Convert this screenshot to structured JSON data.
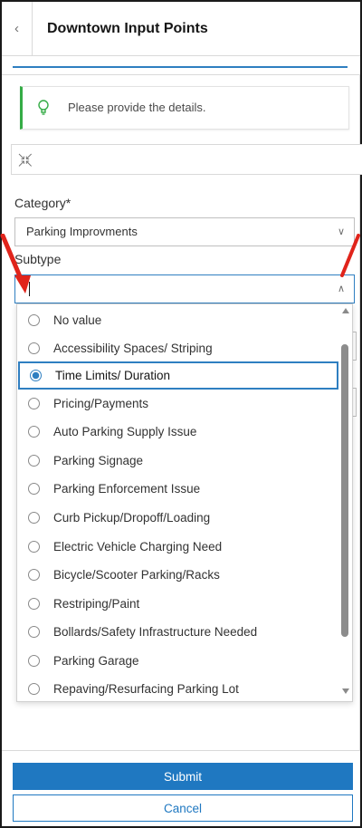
{
  "header": {
    "back_icon": "chevron-left-icon",
    "title": "Downtown Input Points"
  },
  "notice": {
    "icon": "lightbulb-icon",
    "text": "Please provide the details.",
    "accent_color": "#35ac46"
  },
  "collapse": {
    "icon": "collapse-arrows-icon"
  },
  "category": {
    "label": "Category*",
    "value": "Parking Improvments"
  },
  "subtype": {
    "label": "Subtype",
    "value": "",
    "options": [
      {
        "label": "No value",
        "selected": false
      },
      {
        "label": "Accessibility Spaces/ Striping",
        "selected": false
      },
      {
        "label": "Time Limits/ Duration",
        "selected": true
      },
      {
        "label": "Pricing/Payments",
        "selected": false
      },
      {
        "label": "Auto Parking Supply Issue",
        "selected": false
      },
      {
        "label": "Parking Signage",
        "selected": false
      },
      {
        "label": "Parking Enforcement Issue",
        "selected": false
      },
      {
        "label": "Curb Pickup/Dropoff/Loading",
        "selected": false
      },
      {
        "label": "Electric Vehicle Charging Need",
        "selected": false
      },
      {
        "label": "Bicycle/Scooter Parking/Racks",
        "selected": false
      },
      {
        "label": "Restriping/Paint",
        "selected": false
      },
      {
        "label": "Bollards/Safety Infrastructure Needed",
        "selected": false
      },
      {
        "label": "Parking Garage",
        "selected": false
      },
      {
        "label": "Repaving/Resurfacing Parking Lot",
        "selected": false
      }
    ]
  },
  "buttons": {
    "submit": "Submit",
    "cancel": "Cancel"
  },
  "colors": {
    "accent_blue": "#1f78c1",
    "annotation_red": "#e0241b"
  }
}
